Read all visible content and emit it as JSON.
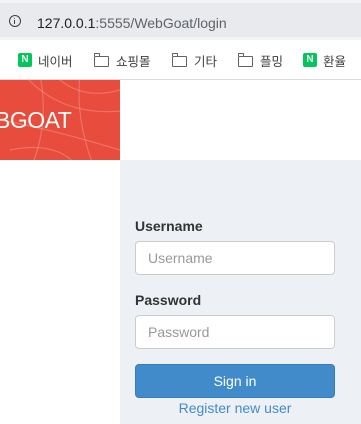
{
  "browser": {
    "url_host": "127.0.0.1",
    "url_path": ":5555/WebGoat/login",
    "bookmarks": [
      {
        "label": "네이버",
        "icon": "naver-icon"
      },
      {
        "label": "쇼핑몰",
        "icon": "folder-icon"
      },
      {
        "label": "기타",
        "icon": "folder-icon"
      },
      {
        "label": "플밍",
        "icon": "folder-icon"
      },
      {
        "label": "환율",
        "icon": "naver-icon"
      }
    ],
    "naver_icon_glyph": "N"
  },
  "header": {
    "logo_text": "BGOAT",
    "brand_color": "#e74c3c"
  },
  "login_form": {
    "username_label": "Username",
    "username_placeholder": "Username",
    "username_value": "",
    "password_label": "Password",
    "password_placeholder": "Password",
    "password_value": "",
    "signin_label": "Sign in",
    "register_label": "Register new user",
    "button_color": "#428bca"
  }
}
